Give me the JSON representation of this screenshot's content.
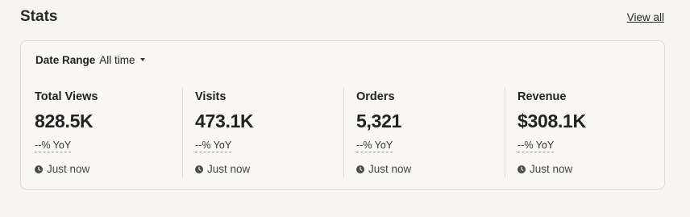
{
  "header": {
    "title": "Stats",
    "view_all_label": "View all"
  },
  "filter": {
    "label": "Date Range",
    "value": "All time"
  },
  "metrics": [
    {
      "label": "Total Views",
      "value": "828.5K",
      "yoy": "--% YoY",
      "updated": "Just now"
    },
    {
      "label": "Visits",
      "value": "473.1K",
      "yoy": "--% YoY",
      "updated": "Just now"
    },
    {
      "label": "Orders",
      "value": "5,321",
      "yoy": "--% YoY",
      "updated": "Just now"
    },
    {
      "label": "Revenue",
      "value": "$308.1K",
      "yoy": "--% YoY",
      "updated": "Just now"
    }
  ],
  "icons": {
    "clock": "clock-icon",
    "caret": "caret-down-icon"
  },
  "colors": {
    "background": "#f6f5f2",
    "card": "#f9f8f5",
    "border": "#dcdad5",
    "text": "#222222"
  }
}
